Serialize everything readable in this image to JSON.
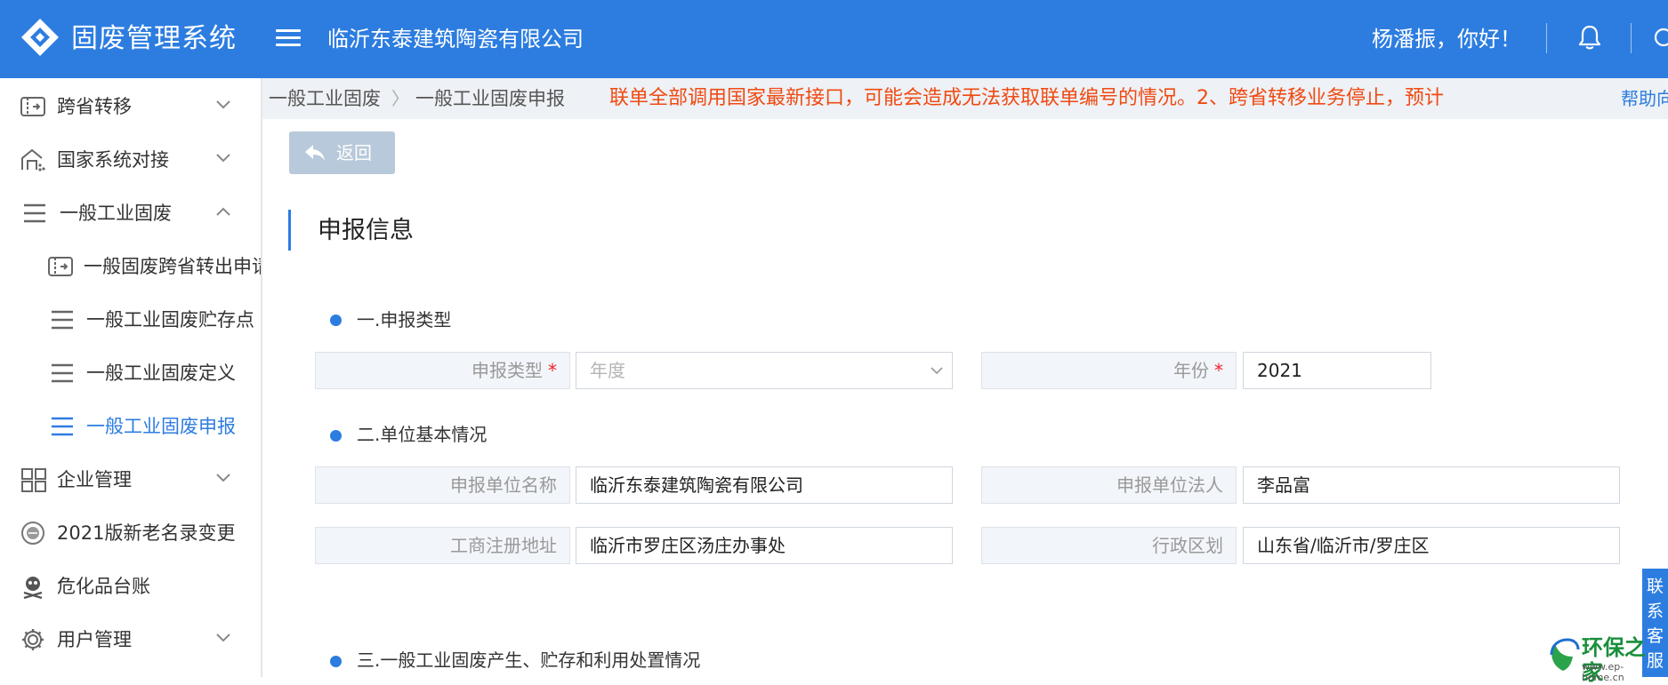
{
  "header": {
    "app_title": "固废管理系统",
    "company_name": "临沂东泰建筑陶瓷有限公司",
    "greeting": "杨潘振，你好！",
    "bg_color": "#2d7de0"
  },
  "sidebar": {
    "items": [
      {
        "label": "跨省转移",
        "icon": "transfer-ticket-icon",
        "expand": "chevron-down"
      },
      {
        "label": "国家系统对接",
        "icon": "building-network-icon",
        "expand": "chevron-down"
      },
      {
        "label": "一般工业固废",
        "icon": "list-icon",
        "expand": "chevron-up"
      },
      {
        "label": "一般固废跨省转出申请",
        "icon": "transfer-ticket-icon",
        "expand": ""
      },
      {
        "label": "一般工业固废贮存点",
        "icon": "list-icon",
        "expand": ""
      },
      {
        "label": "一般工业固废定义",
        "icon": "list-icon",
        "expand": ""
      },
      {
        "label": "一般工业固废申报",
        "icon": "list-icon",
        "expand": "",
        "active": true
      },
      {
        "label": "企业管理",
        "icon": "grid-icon",
        "expand": "chevron-down"
      },
      {
        "label": "2021版新老名录变更",
        "icon": "seal-icon",
        "expand": ""
      },
      {
        "label": "危化品台账",
        "icon": "skull-icon",
        "expand": ""
      },
      {
        "label": "用户管理",
        "icon": "gear-icon",
        "expand": "chevron-down"
      }
    ]
  },
  "breadcrumb": {
    "items": [
      "一般工业固废",
      "一般工业固废申报"
    ],
    "separator": "〉",
    "notice": "联单全部调用国家最新接口，可能会造成无法获取联单编号的情况。2、跨省转移业务停止，预计",
    "help": "帮助向"
  },
  "toolbar": {
    "back_label": "返回"
  },
  "section": {
    "title": "申报信息"
  },
  "form": {
    "sub1": "一.申报类型",
    "report_type_label": "申报类型",
    "report_type_placeholder": "年度",
    "year_label": "年份",
    "year_value": "2021",
    "required_mark": "*",
    "sub2": "二.单位基本情况",
    "unit_name_label": "申报单位名称",
    "unit_name_value": "临沂东泰建筑陶瓷有限公司",
    "legal_person_label": "申报单位法人",
    "legal_person_value": "李品富",
    "reg_address_label": "工商注册地址",
    "reg_address_value": "临沂市罗庄区汤庄办事处",
    "region_label": "行政区划",
    "region_value": "山东省/临沂市/罗庄区",
    "sub3": "三.一般工业固废产生、贮存和利用处置情况"
  },
  "contact": {
    "label": "联系客服"
  },
  "watermark": {
    "text": "环保之家",
    "sub": "www.ep-home.cn"
  }
}
